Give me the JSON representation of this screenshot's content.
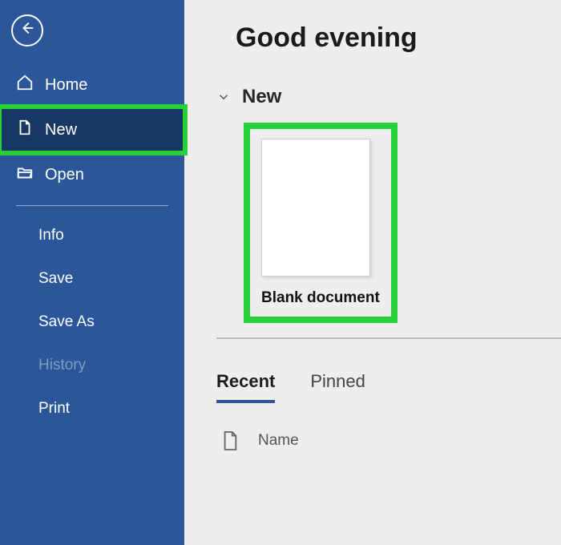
{
  "greeting": "Good evening",
  "sidebar": {
    "home": "Home",
    "new": "New",
    "open": "Open",
    "info": "Info",
    "save": "Save",
    "save_as": "Save As",
    "history": "History",
    "print": "Print"
  },
  "main": {
    "section_new": "New",
    "template_blank": "Blank document",
    "tab_recent": "Recent",
    "tab_pinned": "Pinned",
    "col_name": "Name"
  },
  "colors": {
    "sidebar": "#2b579a",
    "highlight": "#26d13a"
  }
}
